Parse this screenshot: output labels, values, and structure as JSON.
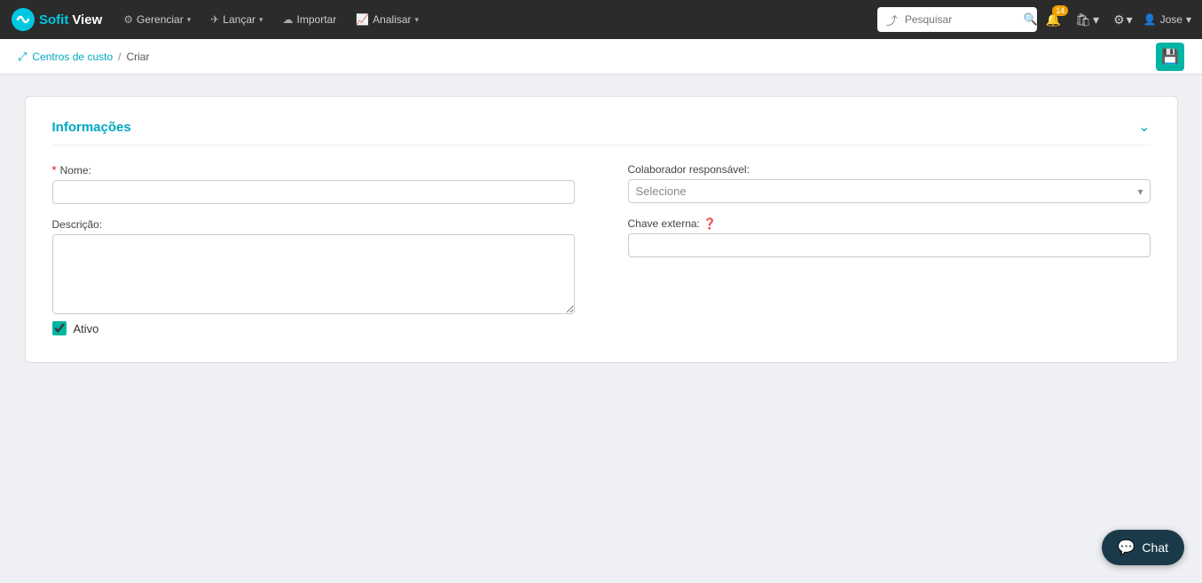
{
  "navbar": {
    "brand_sofit": "Sofit",
    "brand_view": "View",
    "menu_items": [
      {
        "label": "Gerenciar",
        "icon": "⚙",
        "has_caret": true
      },
      {
        "label": "Lançar",
        "icon": "✈",
        "has_caret": true
      },
      {
        "label": "Importar",
        "icon": "☁",
        "has_caret": false
      },
      {
        "label": "Analisar",
        "icon": "📈",
        "has_caret": true
      }
    ],
    "search_placeholder": "Pesquisar",
    "notifications_count": "14",
    "user_label": "Jose"
  },
  "breadcrumb": {
    "parent_label": "Centros de custo",
    "separator": "/",
    "current_label": "Criar"
  },
  "save_button_label": "💾",
  "form": {
    "section_title": "Informações",
    "fields": {
      "nome_label": "Nome:",
      "nome_required": "*",
      "nome_placeholder": "",
      "descricao_label": "Descrição:",
      "descricao_placeholder": "",
      "colaborador_label": "Colaborador responsável:",
      "colaborador_placeholder": "Selecione",
      "chave_externa_label": "Chave externa:",
      "chave_externa_placeholder": "",
      "ativo_label": "Ativo"
    }
  },
  "chat": {
    "label": "Chat"
  }
}
